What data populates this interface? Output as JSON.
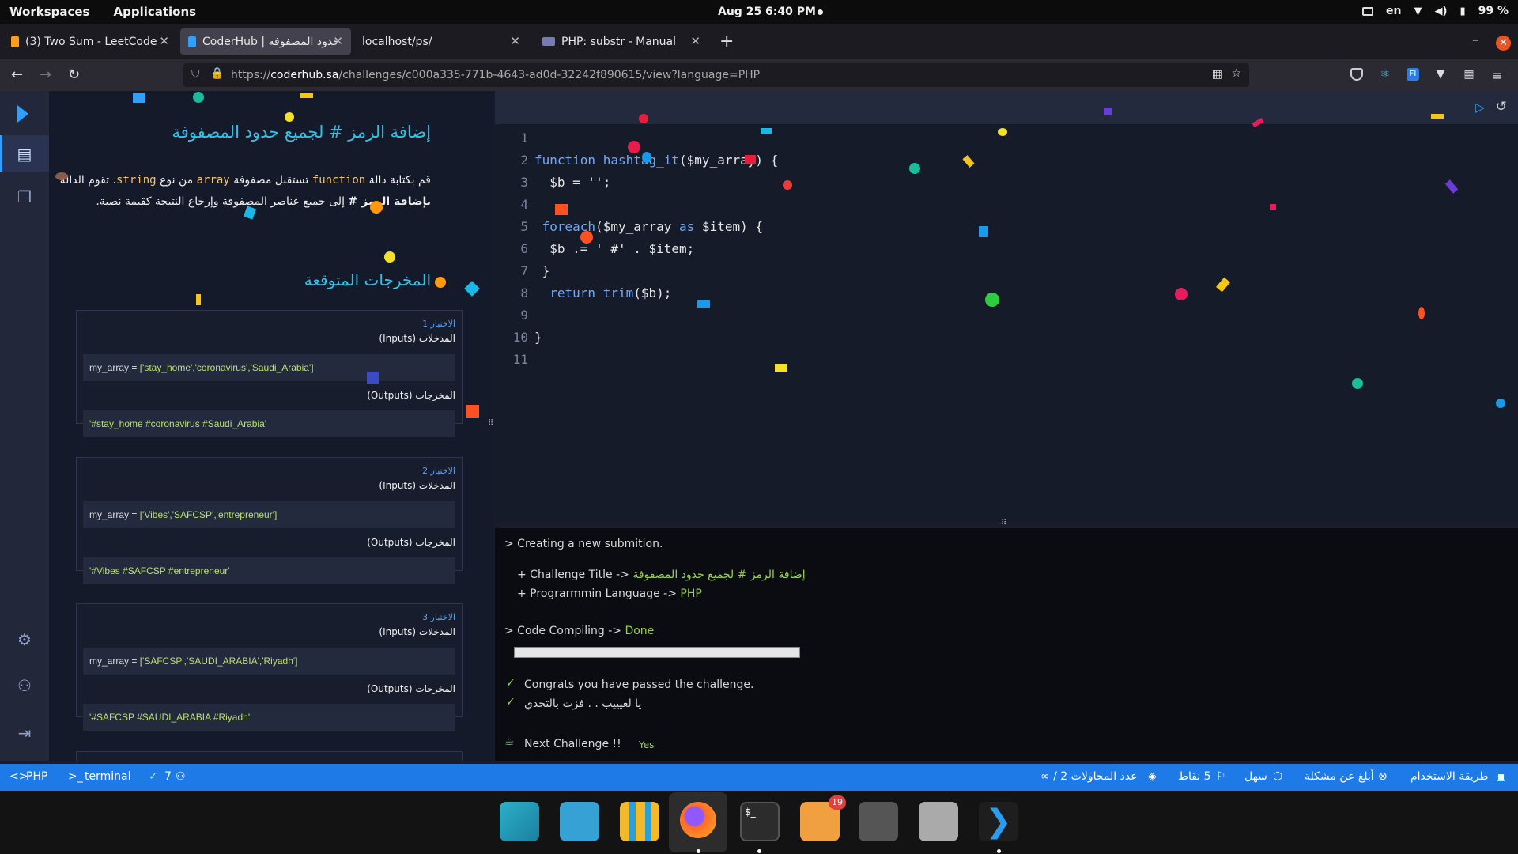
{
  "system_bar": {
    "workspaces": "Workspaces",
    "applications": "Applications",
    "datetime": "Aug 25  6:40 PM",
    "lang": "en",
    "battery": "99 %"
  },
  "browser": {
    "tabs": [
      {
        "label": "(3) Two Sum - LeetCode",
        "active": false
      },
      {
        "label": "CoderHub | حدود المصفوفة ...",
        "active": true
      },
      {
        "label": "localhost/ps/",
        "active": false
      },
      {
        "label": "PHP: substr - Manual",
        "active": false
      }
    ],
    "url_prefix": "https://",
    "url_host": "coderhub.sa",
    "url_path": "/challenges/c000a335-771b-4643-ad0d-32242f890615/view?language=PHP"
  },
  "challenge": {
    "title": "إضافة الرمز # لجميع حدود المصفوفة",
    "desc_part1": "قم بكتابة دالة ",
    "kw_function": "function",
    "desc_part2": " تستقبل مصفوفة ",
    "kw_array": "array",
    "desc_part3": " من نوع ",
    "kw_string": "string",
    "desc_part4": ". تقوم الدالة ",
    "desc_bold": "بإضافة الرمز #",
    "desc_part5": " إلى جميع عناصر المصفوفة وإرجاع النتيجة كقيمة نصية.",
    "expected_title": "المخرجات المتوقعة",
    "tests": [
      {
        "no": "الاختبار 1",
        "inputs_label": "المدخلات (Inputs)",
        "input_name": "my_array = ",
        "input_value": "['stay_home','coronavirus','Saudi_Arabia']",
        "outputs_label": "المخرجات (Outputs)",
        "output": "'#stay_home #coronavirus #Saudi_Arabia'"
      },
      {
        "no": "الاختبار 2",
        "inputs_label": "المدخلات (Inputs)",
        "input_name": "my_array = ",
        "input_value": "['Vibes','SAFCSP','entrepreneur']",
        "outputs_label": "المخرجات (Outputs)",
        "output": "'#Vibes #SAFCSP #entrepreneur'"
      },
      {
        "no": "الاختبار 3",
        "inputs_label": "المدخلات (Inputs)",
        "input_name": "my_array = ",
        "input_value": "['SAFCSP','SAUDI_ARABIA','Riyadh']",
        "outputs_label": "المخرجات (Outputs)",
        "output": "'#SAFCSP #SAUDI_ARABIA #Riyadh'"
      }
    ]
  },
  "code_lines": [
    "1",
    "2",
    "3",
    "4",
    "5",
    "6",
    "7",
    "8",
    "9",
    "10",
    "11"
  ],
  "code": {
    "l2a": "function",
    "l2b": " hashtag_it",
    "l2c": "($my_array) {",
    "l3": "  $b = '';",
    "l5a": " foreach",
    "l5b": "($my_array ",
    "l5c": "as",
    "l5d": " $item) {",
    "l6": "  $b .= ' #' . $item;",
    "l7": " }",
    "l8a": "  return",
    "l8b": " trim",
    "l8c": "($b);",
    "l10": "}"
  },
  "terminal": {
    "l1": "> Creating a new submition.",
    "l2a": "+ Challenge Title -> ",
    "l2b": "إضافة الرمز # لجميع حدود المصفوفة",
    "l3a": "+ Prograrmmin Language -> ",
    "l3b": "PHP",
    "l4a": "> Code Compiling -> ",
    "l4b": "Done",
    "progress": 1.0,
    "l5": "Congrats you have passed the challenge.",
    "l6": "يا لعيييب . . فزت بالتحدي",
    "next": "Next Challenge !!",
    "yes": "Yes"
  },
  "statusbar": {
    "lang": "PHP",
    "terminal": "terminal",
    "users": "7",
    "attempts": "عدد المحاولات 2 / ∞",
    "points": "5 نقاط",
    "level": "سهل",
    "report": "أبلغ عن مشكلة",
    "usage": "طريقة الاستخدام"
  },
  "dock": {
    "badge": "19"
  },
  "colors": {
    "accent": "#2fc3e8",
    "status": "#1e7ae6",
    "green": "#9bd44a"
  }
}
